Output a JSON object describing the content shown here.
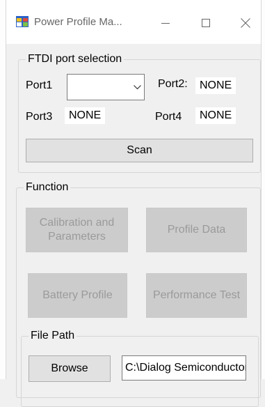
{
  "window": {
    "title": "Power Profile Ma...",
    "icon": "app-icon",
    "controls": {
      "minimize": "minimize-icon",
      "maximize": "maximize-icon",
      "close": "close-icon"
    }
  },
  "ftdi": {
    "legend": "FTDI port selection",
    "port1": {
      "label": "Port1",
      "value": ""
    },
    "port2": {
      "label": "Port2:",
      "value": "NONE"
    },
    "port3": {
      "label": "Port3",
      "value": "NONE"
    },
    "port4": {
      "label": "Port4",
      "value": "NONE"
    },
    "scan_label": "Scan"
  },
  "function": {
    "legend": "Function",
    "calibration_label": "Calibration and Parameters",
    "profile_data_label": "Profile Data",
    "battery_profile_label": "Battery Profile",
    "performance_test_label": "Performance Test"
  },
  "file_path": {
    "legend": "File Path",
    "browse_label": "Browse",
    "path_value": "C:\\Dialog Semiconductor"
  },
  "colors": {
    "disabled_button": "#cccccc",
    "disabled_text": "#9a9a9a",
    "window_bg": "#f0f0f0"
  }
}
